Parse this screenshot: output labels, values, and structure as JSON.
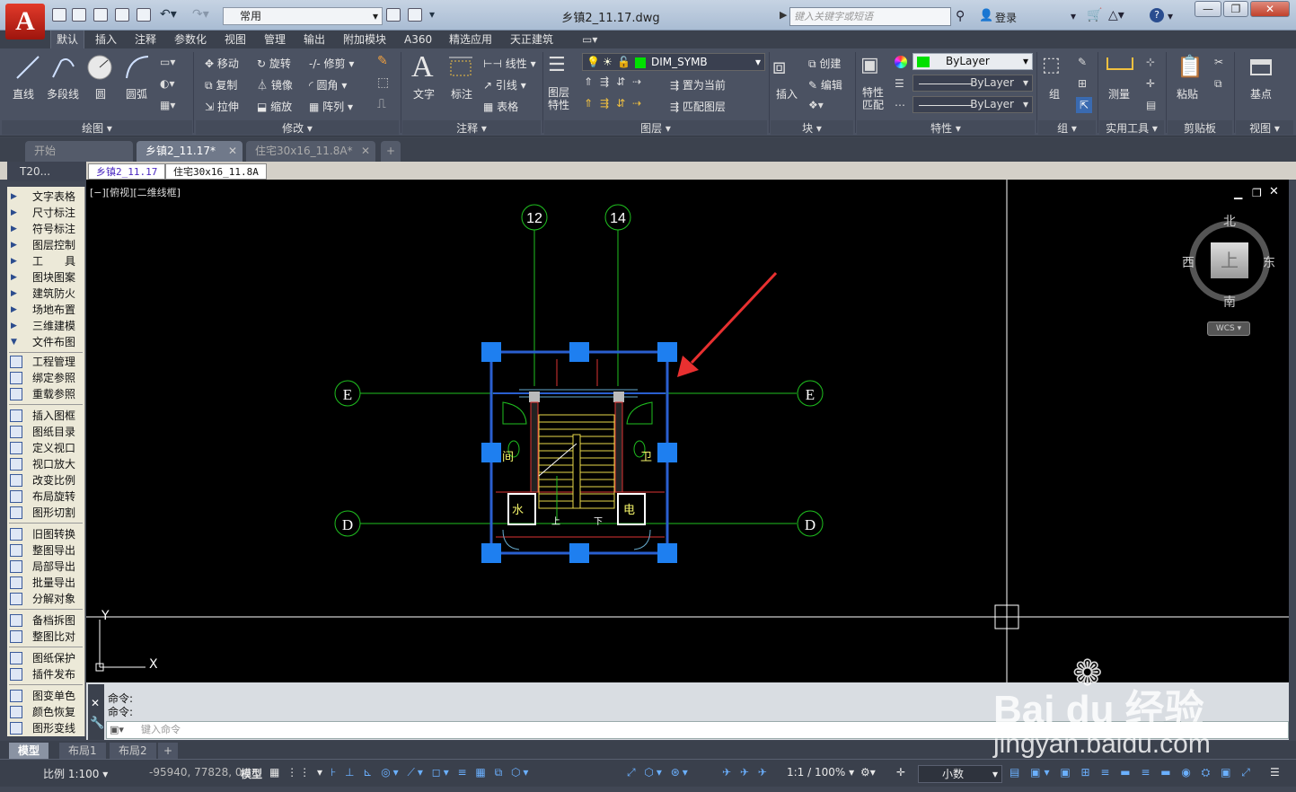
{
  "app": {
    "logo_letter": "A",
    "doc_title": "乡镇2_11.17.dwg",
    "workspace": "常用",
    "search_placeholder": "键入关键字或短语",
    "login": "登录"
  },
  "ribbon_tabs": [
    "默认",
    "插入",
    "注释",
    "参数化",
    "视图",
    "管理",
    "输出",
    "附加模块",
    "A360",
    "精选应用",
    "天正建筑"
  ],
  "panels": {
    "draw": {
      "label": "绘图 ▾",
      "line": "直线",
      "polyline": "多段线",
      "circle": "圆",
      "arc": "圆弧"
    },
    "modify": {
      "label": "修改 ▾",
      "move": "移动",
      "rotate": "旋转",
      "trim": "修剪",
      "copy": "复制",
      "mirror": "镜像",
      "fillet": "圆角",
      "stretch": "拉伸",
      "scale": "缩放",
      "array": "阵列"
    },
    "annotation": {
      "label": "注释 ▾",
      "text": "文字",
      "dimension": "标注",
      "linetype": "线性",
      "leader": "引线",
      "table": "表格"
    },
    "layers": {
      "label": "图层 ▾",
      "props": "图层\n特性",
      "current_layer": "DIM_SYMB",
      "set_current": "置为当前",
      "match_layer": "匹配图层"
    },
    "block": {
      "label": "块 ▾",
      "insert": "插入",
      "create": "创建",
      "edit": "编辑"
    },
    "properties": {
      "label": "特性 ▾",
      "match": "特性\n匹配",
      "color": "ByLayer",
      "linetype": "ByLayer",
      "lineweight": "ByLayer"
    },
    "groups": {
      "label": "组 ▾",
      "group": "组"
    },
    "utilities": {
      "label": "实用工具 ▾",
      "measure": "测量"
    },
    "clipboard": {
      "label": "剪贴板",
      "paste": "粘贴"
    },
    "view": {
      "label": "视图 ▾",
      "base": "基点"
    }
  },
  "doc_tabs": [
    "开始",
    "乡镇2_11.17*",
    "住宅30x16_11.8A*"
  ],
  "sub_tabs": {
    "t20": "T20...",
    "tab1": "乡镇2_11.17",
    "tab2": "住宅30x16_11.8A"
  },
  "sidebar": {
    "group1": [
      "文字表格",
      "尺寸标注",
      "符号标注",
      "图层控制",
      "工　　具",
      "图块图案",
      "建筑防火",
      "场地布置",
      "三维建模",
      "文件布图"
    ],
    "group2": [
      "工程管理",
      "绑定参照",
      "重载参照"
    ],
    "group3": [
      "插入图框",
      "图纸目录",
      "定义视口",
      "视口放大",
      "改变比例",
      "布局旋转",
      "图形切割"
    ],
    "group4": [
      "旧图转换",
      "整图导出",
      "局部导出",
      "批量导出",
      "分解对象"
    ],
    "group5": [
      "备档拆图",
      "整图比对"
    ],
    "group6": [
      "图纸保护",
      "插件发布"
    ],
    "group7": [
      "图变单色",
      "颜色恢复",
      "图形变线"
    ]
  },
  "canvas": {
    "view_label": "[−][俯视][二维线框]",
    "axis_top": [
      "12",
      "14"
    ],
    "axis_side": [
      "E",
      "D"
    ],
    "rooms": {
      "left": "间",
      "right": "卫",
      "water": "水",
      "elec": "电",
      "up": "上",
      "down": "下"
    },
    "ucs": {
      "x": "X",
      "y": "Y"
    }
  },
  "viewcube": {
    "north": "北",
    "south": "南",
    "west": "西",
    "east": "东",
    "top": "上",
    "wcs": "WCS"
  },
  "command": {
    "history": [
      "命令:",
      "命令:"
    ],
    "placeholder": "键入命令"
  },
  "layout_tabs": [
    "模型",
    "布局1",
    "布局2"
  ],
  "status": {
    "scale": "比例 1:100",
    "coords": "-95940, 77828, 0",
    "model": "模型",
    "annotation_scale": "1:1 / 100%",
    "units": "小数"
  },
  "watermark": {
    "text": "Bai du 经验",
    "url": "jingyan.baidu.com"
  }
}
